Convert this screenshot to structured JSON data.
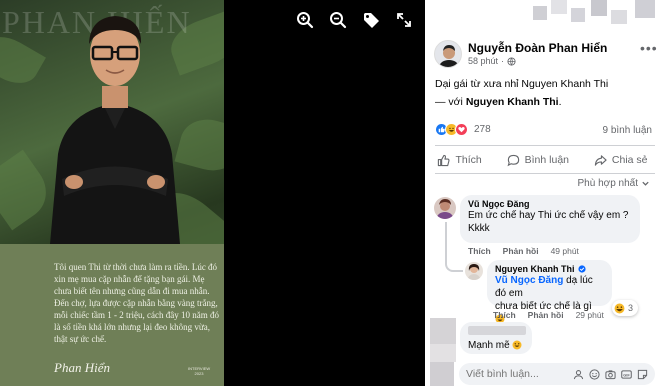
{
  "viewer": {
    "brand_top": "PHAN HIẾN",
    "caption": "Tôi quen Thi từ thời chưa làm ra tiền. Lúc đó xin mẹ mua cặp nhẫn để tặng bạn gái. Mẹ chưa biết tên nhưng cũng dẫn đi mua nhẫn. Đến chợ, lựa được cặp nhẫn bằng vàng trắng, mỗi chiếc tầm 1 - 2 triệu, cách đây 10 năm đó là số tiền khá lớn nhưng lại đeo không vừa, thật sự ức chế.",
    "signature": "Phan Hiển",
    "tag": "INTERVIEW 2023",
    "toolbar": [
      "zoom-in-icon",
      "zoom-out-icon",
      "tag-icon",
      "fullscreen-icon"
    ]
  },
  "post": {
    "author": "Nguyễn Đoàn Phan Hiển",
    "time": "58 phút",
    "text_line1": "Dại gái từ xưa nhỉ Nguyen Khanh Thi",
    "with_prefix": "— với",
    "with_name": "Nguyen Khanh Thi",
    "with_suffix": ".",
    "reaction_count": "278",
    "comment_count": "9 bình luận",
    "actions": {
      "like": "Thích",
      "comment": "Bình luận",
      "share": "Chia sẻ"
    },
    "sort_label": "Phù hợp nhất"
  },
  "comments": [
    {
      "name": "Vũ Ngọc Đăng",
      "text_line1": "Em ức chế hay Thi ức chế vậy em ?",
      "text_line2": "Kkkk",
      "like": "Thích",
      "reply": "Phản hồi",
      "time": "49 phút"
    },
    {
      "name": "Nguyen Khanh Thi",
      "mention": "Vũ Ngọc Đăng",
      "text_rest": " dạ lúc đó em",
      "text_line2": "chưa biết ức chế là gì",
      "reaction_count": "3",
      "like": "Thích",
      "reply": "Phản hồi",
      "time": "29 phút"
    },
    {
      "name": "",
      "text": "Mạnh mẽ"
    }
  ],
  "input": {
    "placeholder": "Viết bình luận..."
  },
  "colors": {
    "brand_blue": "#0866ff",
    "muted": "#65676b",
    "bubble": "#f0f2f5"
  }
}
